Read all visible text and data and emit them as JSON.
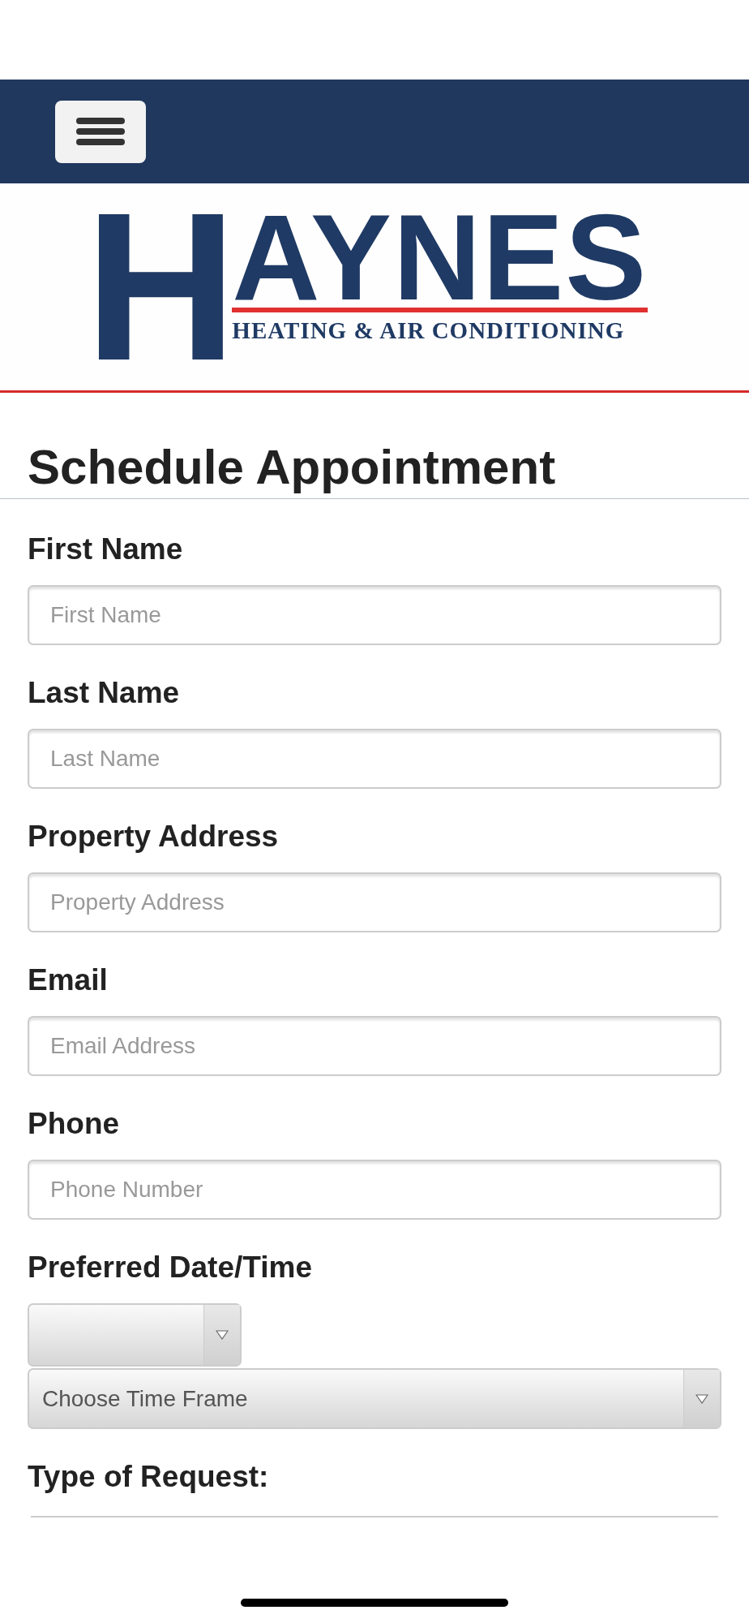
{
  "logo": {
    "initial": "H",
    "rest": "AYNES",
    "tagline": "HEATING & AIR CONDITIONING"
  },
  "title": "Schedule Appointment",
  "fields": [
    {
      "label": "First Name",
      "placeholder": "First Name"
    },
    {
      "label": "Last Name",
      "placeholder": "Last Name"
    },
    {
      "label": "Property Address",
      "placeholder": "Property Address"
    },
    {
      "label": "Email",
      "placeholder": "Email Address"
    },
    {
      "label": "Phone",
      "placeholder": "Phone Number"
    }
  ],
  "preferred": {
    "label": "Preferred Date/Time",
    "time_select": "Choose Time Frame"
  },
  "request": {
    "label": "Type of Request:"
  }
}
